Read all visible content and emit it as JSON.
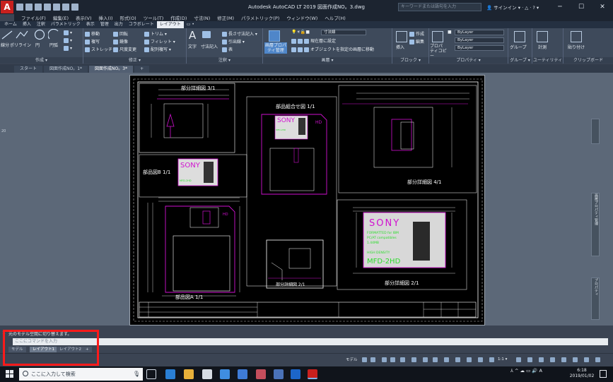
{
  "app": {
    "logo": "A",
    "logo_sub": "LT",
    "window_title": "Autodesk AutoCAD LT 2019   図面作成NO。3.dwg",
    "search_placeholder": "キーワードまたは語句を入力",
    "signin_label": "サインイン",
    "minimize": "─",
    "maximize": "☐",
    "close": "✕"
  },
  "menubar": [
    "ファイル(F)",
    "編集(E)",
    "表示(V)",
    "挿入(I)",
    "形式(O)",
    "ツール(T)",
    "作成(D)",
    "寸法(N)",
    "修正(M)",
    "パラメトリック(P)",
    "ウィンドウ(W)",
    "ヘルプ(H)"
  ],
  "ribbon_tabs": [
    {
      "label": "ホーム",
      "active": false
    },
    {
      "label": "挿入",
      "active": false
    },
    {
      "label": "注釈",
      "active": false
    },
    {
      "label": "パラメトリック",
      "active": false
    },
    {
      "label": "表示",
      "active": false
    },
    {
      "label": "管理",
      "active": false
    },
    {
      "label": "出力",
      "active": false
    },
    {
      "label": "コラボレート",
      "active": false
    },
    {
      "label": "レイアウト",
      "active": true
    },
    {
      "label": "▭ •",
      "active": false
    }
  ],
  "ribbon": {
    "draw": {
      "title": "作成 ▾",
      "line": "線分",
      "polyline": "ポリライン",
      "circle": "円",
      "arc": "円弧"
    },
    "modify": {
      "title": "修正 ▾",
      "move": "移動",
      "rotate": "回転",
      "trim": "トリム",
      "copy": "複写",
      "mirror": "鏡像",
      "fillet": "フィレット",
      "stretch": "ストレッチ",
      "scale": "尺度変更",
      "array": "配列複写"
    },
    "annotation": {
      "title": "注釈 ▾",
      "text": "文字",
      "dim": "寸法記入",
      "linear": "長さ寸法記入",
      "leader": "引出線",
      "table": "表"
    },
    "layers": {
      "title": "画層 ▾",
      "props": "画層プロパティ管理",
      "current": "寸法線",
      "set_current": "現在層に設定",
      "match": "オブジェクトを指定の画層に移動"
    },
    "block": {
      "title": "ブロック ▾",
      "insert": "挿入",
      "create": "作成",
      "edit": "編集"
    },
    "properties": {
      "title": "プロパティ ▾",
      "match": "プロパティコピー",
      "color": "ByLayer",
      "linetype": "ByLayer",
      "lineweight": "ByLayer"
    },
    "groups": {
      "title": "グループ ▾",
      "group": "グループ"
    },
    "utilities": {
      "title": "ユーティリティ ▾",
      "measure": "計測"
    },
    "clipboard": {
      "title": "クリップボード",
      "paste": "貼り付け"
    }
  },
  "doc_tabs": [
    {
      "label": "スタート",
      "active": false
    },
    {
      "label": "図面作成NO。1*",
      "active": false
    },
    {
      "label": "図面作成NO。3*",
      "active": true
    },
    {
      "label": "+",
      "active": false
    }
  ],
  "drawing": {
    "views": [
      "部分詳細図 3/1",
      "部品組合せ図 1/1",
      "部品図B 1/1",
      "部分詳細図 4/1",
      "部品図A 1/1",
      "部分詳細図 2/1",
      "部分詳細図 2/1"
    ],
    "brand": "SONY",
    "floppy_label": {
      "line1": "FORMATTED for IBM",
      "line2": "PC/AT compatibles",
      "line3": "1.44MB",
      "line4": "HIGH DENSITY",
      "line5": "MFD-2HD"
    },
    "side_mark": "HD"
  },
  "palettes": {
    "properties": "プロパティ",
    "layer_props": "画層プロパティ管理"
  },
  "ruler_mark": "20",
  "command": {
    "history": "元のモデル空間に切り替えます。",
    "placeholder": "ここにコマンドを入力",
    "close": "✕"
  },
  "layout_tabs": [
    {
      "label": "モデル",
      "active": false
    },
    {
      "label": "レイアウト1",
      "active": true
    },
    {
      "label": "レイアウト2",
      "active": false
    },
    {
      "label": "+",
      "active": false
    }
  ],
  "statusbar": {
    "space": "モデル",
    "scale": "1:1 ▾"
  },
  "taskbar": {
    "search_placeholder": "ここに入力して検索",
    "time": "6:18",
    "date": "2019/01/02",
    "ime": "A"
  },
  "colors": {
    "titlebar": "#1c2430",
    "paper": "#000000",
    "workspace": "#5c6878",
    "drawing_lines": "#ffffff",
    "magenta": "#d011d0",
    "label_green": "#2bdc2b",
    "highlight": "#ff1a1a"
  }
}
